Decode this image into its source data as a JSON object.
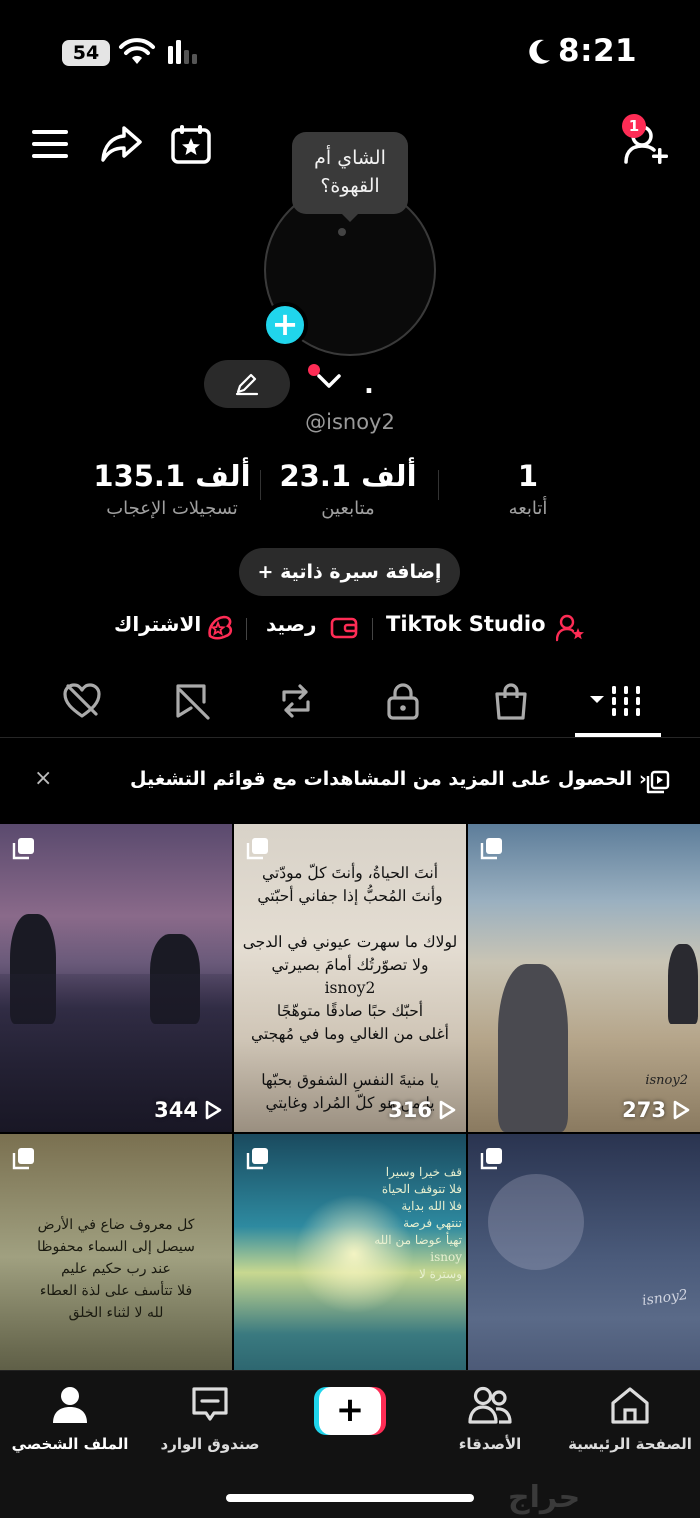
{
  "status_bar": {
    "battery": "54",
    "time": "8:21"
  },
  "header": {
    "notification_count": "1"
  },
  "profile": {
    "tooltip": "الشاي أم القهوة؟",
    "name_dot": ".",
    "username": "@isnoy2",
    "stats": {
      "likes": {
        "value": "135.1 ألف",
        "label": "تسجيلات الإعجاب"
      },
      "followers": {
        "value": "23.1 ألف",
        "label": "متابعين"
      },
      "following": {
        "value": "1",
        "label": "أتابعه"
      }
    },
    "add_bio": "+ إضافة سيرة ذاتية",
    "links": {
      "subscription": "الاشتراك",
      "balance": "رصيد",
      "studio": "TikTok Studio"
    }
  },
  "playlist_banner": {
    "text": "الحصول على المزيد من المشاهدات مع قوائم التشغيل ›",
    "close": "×"
  },
  "videos": [
    {
      "views": "344"
    },
    {
      "views": "316",
      "text": "أنتَ الحياةُ، وأنتَ كلّ مودّتي\nوأنتَ المُحبُّ إذا جفاني أحبّتي\n\nلولاك ما سهرت عيوني في الدجى\nولا تصوّرتُك أمامَ بصيرتي\nisnoy2\nأحبّك حبًا صادقًا متوهّجًا\nأغلى من الغالي وما في مُهجتي\n\nيا منيةَ النفسِ الشفوق بحبّها\nيا من هو كلّ المُراد وغايتي"
    },
    {
      "views": "273",
      "watermark": "isnoy2"
    },
    {
      "text": "كل معروف ضاع في الأرض\nسيصل إلى السماء محفوظا\nعند رب حكيم عليم\nفلا تتأسف على لذة العطاء\nلله لا لثناء الخلق"
    },
    {
      "text": "قف خيرا وسيرا\nفلا تتوقف الحياة\nفلا الله بداية\nتنتهي فرصة\nتهيأ عوضا من الله\nisnoy\nوسترة لا"
    },
    {
      "watermark": "isnoy2"
    }
  ],
  "bottom_nav": {
    "home": "الصفحة الرئيسية",
    "friends": "الأصدقاء",
    "create": "+",
    "inbox": "صندوق الوارد",
    "profile": "الملف الشخصي"
  },
  "watermark": "حراج",
  "colors": {
    "accent_pink": "#fe2c55",
    "accent_cyan": "#20d5ec",
    "background": "#000000"
  }
}
